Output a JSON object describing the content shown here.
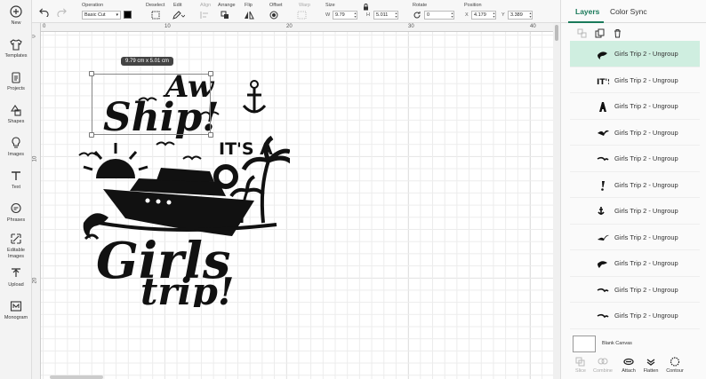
{
  "sidebar": {
    "items": [
      {
        "label": "New",
        "icon": "plus-circle-icon"
      },
      {
        "label": "Templates",
        "icon": "shirt-icon"
      },
      {
        "label": "Projects",
        "icon": "clipboard-icon"
      },
      {
        "label": "Shapes",
        "icon": "shapes-icon"
      },
      {
        "label": "Images",
        "icon": "lightbulb-icon"
      },
      {
        "label": "Text",
        "icon": "text-t-icon"
      },
      {
        "label": "Phrases",
        "icon": "speech-bubble-icon"
      },
      {
        "label": "Editable Images",
        "icon": "editable-image-icon"
      },
      {
        "label": "Upload",
        "icon": "upload-icon"
      },
      {
        "label": "Monogram",
        "icon": "monogram-icon"
      }
    ]
  },
  "toolbar": {
    "operation_label": "Operation",
    "operation_value": "Basic Cut",
    "deselect_label": "Deselect",
    "edit_label": "Edit",
    "align_label": "Align",
    "arrange_label": "Arrange",
    "flip_label": "Flip",
    "offset_label": "Offset",
    "warp_label": "Warp",
    "size_label": "Size",
    "width_letter": "W",
    "width_value": "9.79",
    "height_letter": "H",
    "height_value": "5.011",
    "rotate_label": "Rotate",
    "rotate_value": "0",
    "position_label": "Position",
    "x_letter": "X",
    "x_value": "4.179",
    "y_letter": "Y",
    "y_value": "3.389",
    "colors": {
      "swatch": "#000000",
      "accent": "#1a7a5a"
    }
  },
  "canvas": {
    "ruler_top": [
      "0",
      "10",
      "20",
      "30",
      "40"
    ],
    "ruler_left": [
      "0",
      "10",
      "20"
    ],
    "dimension_tag": "9.79  cm x 5.01  cm",
    "design_text": {
      "line1": "Aw",
      "line2": "Ship!",
      "line3": "IT'S A",
      "line4": "Girls",
      "line5": "trip!"
    }
  },
  "panel": {
    "tabs": [
      {
        "label": "Layers"
      },
      {
        "label": "Color Sync"
      }
    ],
    "layers": [
      {
        "name": "Girls Trip 2 - Ungroup",
        "thumb": "dolphin-icon",
        "selected": true
      },
      {
        "name": "Girls Trip 2 - Ungroup",
        "thumb": "its-text-icon",
        "selected": false
      },
      {
        "name": "Girls Trip 2 - Ungroup",
        "thumb": "letter-a-icon",
        "selected": false
      },
      {
        "name": "Girls Trip 2 - Ungroup",
        "thumb": "bird-icon",
        "selected": false
      },
      {
        "name": "Girls Trip 2 - Ungroup",
        "thumb": "bird-icon",
        "selected": false
      },
      {
        "name": "Girls Trip 2 - Ungroup",
        "thumb": "exclamation-icon",
        "selected": false
      },
      {
        "name": "Girls Trip 2 - Ungroup",
        "thumb": "anchor-icon",
        "selected": false
      },
      {
        "name": "Girls Trip 2 - Ungroup",
        "thumb": "bird-icon",
        "selected": false
      },
      {
        "name": "Girls Trip 2 - Ungroup",
        "thumb": "dolphin-icon",
        "selected": false
      },
      {
        "name": "Girls Trip 2 - Ungroup",
        "thumb": "bird-icon",
        "selected": false
      },
      {
        "name": "Girls Trip 2 - Ungroup",
        "thumb": "bird-icon",
        "selected": false
      }
    ],
    "blank_canvas_label": "Blank Canvas",
    "actions": [
      {
        "label": "Slice",
        "enabled": false
      },
      {
        "label": "Combine",
        "enabled": false
      },
      {
        "label": "Attach",
        "enabled": true
      },
      {
        "label": "Flatten",
        "enabled": true
      },
      {
        "label": "Contour",
        "enabled": true
      }
    ]
  }
}
